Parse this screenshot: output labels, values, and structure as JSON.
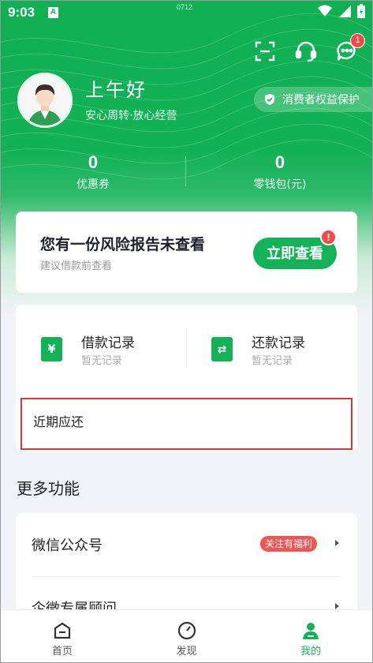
{
  "status_bar": {
    "time": "9:03",
    "a_icon_label": "A",
    "center_text": "0712"
  },
  "top_actions": {
    "message_badge": "1"
  },
  "profile": {
    "greeting": "上午好",
    "subtitle": "安心周转·放心经营",
    "protection_label": "消费者权益保护"
  },
  "stats": [
    {
      "value": "0",
      "label": "优惠券"
    },
    {
      "value": "0",
      "label": "零钱包(元)"
    }
  ],
  "risk_card": {
    "title": "您有一份风险报告未查看",
    "subtitle": "建议借款前查看",
    "button_label": "立即查看",
    "alert_mark": "!"
  },
  "records": [
    {
      "icon": "¥",
      "title": "借款记录",
      "status": "暂无记录"
    },
    {
      "icon": "⇄",
      "title": "还款记录",
      "status": "暂无记录"
    }
  ],
  "recent_due": {
    "label": "近期应还"
  },
  "more": {
    "title": "更多功能",
    "items": [
      {
        "label": "微信公众号",
        "tag": "关注有福利"
      },
      {
        "label": "企微专属顾问",
        "tag": ""
      }
    ]
  },
  "tabbar": [
    {
      "label": "首页",
      "active": false
    },
    {
      "label": "发现",
      "active": false
    },
    {
      "label": "我的",
      "active": true
    }
  ],
  "colors": {
    "brand_green": "#14b257",
    "alert_red": "#f24a4a",
    "highlight_border": "#d43a3a"
  }
}
